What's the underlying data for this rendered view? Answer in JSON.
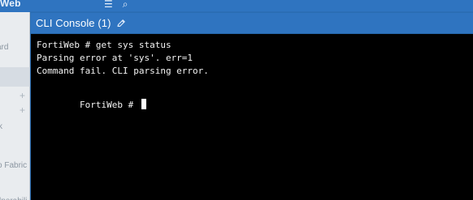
{
  "background_app": {
    "title_fragment": "Web",
    "topbar_icons": [
      "menu-icon",
      "search-icon"
    ],
    "sidebar_fragments": {
      "board": "ard",
      "k": "k",
      "fabric": "o Fabric",
      "vuln": "lnerabili"
    },
    "plus_signs": [
      "+",
      "+"
    ]
  },
  "console": {
    "title": "CLI Console (1)",
    "icons": {
      "edit": "pencil-icon"
    },
    "lines": [
      "FortiWeb # get sys status",
      "Parsing error at 'sys'. err=1",
      "Command fail. CLI parsing error."
    ],
    "prompt": "FortiWeb # "
  },
  "colors": {
    "header_blue": "#2f74c0",
    "terminal_bg": "#000000",
    "terminal_fg": "#f4f4f4",
    "page_bg": "#dfe3e8"
  }
}
